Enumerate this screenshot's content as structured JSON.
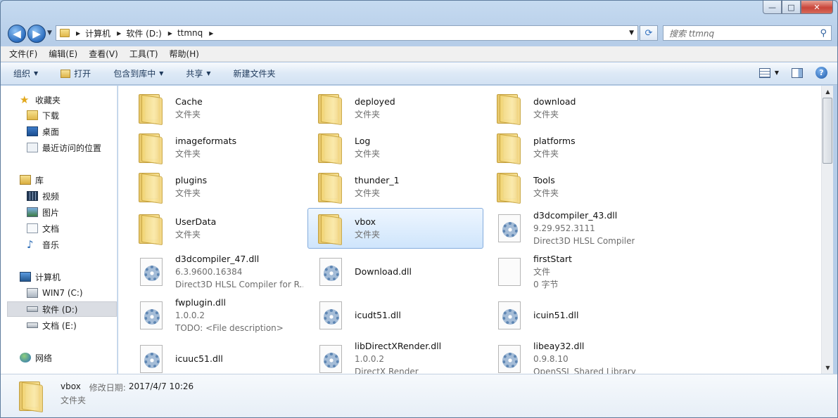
{
  "window": {
    "caption": {
      "minimize": "—",
      "maximize": "□",
      "close": "✕"
    }
  },
  "nav": {
    "back": "◀",
    "forward": "▶"
  },
  "address": {
    "crumbs": [
      "计算机",
      "软件 (D:)",
      "ttmnq"
    ]
  },
  "search": {
    "placeholder": "搜索 ttmnq"
  },
  "menubar": [
    "文件(F)",
    "编辑(E)",
    "查看(V)",
    "工具(T)",
    "帮助(H)"
  ],
  "commands": {
    "organize": "组织",
    "open": "打开",
    "include_library": "包含到库中",
    "share": "共享",
    "new_folder": "新建文件夹"
  },
  "navpane": {
    "favorites": "收藏夹",
    "downloads": "下载",
    "desktop": "桌面",
    "recent": "最近访问的位置",
    "libraries": "库",
    "videos": "视频",
    "pictures": "图片",
    "documents": "文档",
    "music": "音乐",
    "computer": "计算机",
    "drive_c": "WIN7 (C:)",
    "drive_d": "软件 (D:)",
    "drive_e": "文档 (E:)",
    "network": "网络"
  },
  "files": [
    {
      "name": "Cache",
      "line2": "文件夹",
      "line3": "",
      "kind": "folder"
    },
    {
      "name": "deployed",
      "line2": "文件夹",
      "line3": "",
      "kind": "folder"
    },
    {
      "name": "download",
      "line2": "文件夹",
      "line3": "",
      "kind": "folder"
    },
    {
      "name": "imageformats",
      "line2": "文件夹",
      "line3": "",
      "kind": "folder"
    },
    {
      "name": "Log",
      "line2": "文件夹",
      "line3": "",
      "kind": "folder"
    },
    {
      "name": "platforms",
      "line2": "文件夹",
      "line3": "",
      "kind": "folder"
    },
    {
      "name": "plugins",
      "line2": "文件夹",
      "line3": "",
      "kind": "folder"
    },
    {
      "name": "thunder_1",
      "line2": "文件夹",
      "line3": "",
      "kind": "folder"
    },
    {
      "name": "Tools",
      "line2": "文件夹",
      "line3": "",
      "kind": "folder"
    },
    {
      "name": "UserData",
      "line2": "文件夹",
      "line3": "",
      "kind": "folder"
    },
    {
      "name": "vbox",
      "line2": "文件夹",
      "line3": "",
      "kind": "folder",
      "selected": true
    },
    {
      "name": "d3dcompiler_43.dll",
      "line2": "9.29.952.3111",
      "line3": "Direct3D HLSL Compiler",
      "kind": "dll"
    },
    {
      "name": "d3dcompiler_47.dll",
      "line2": "6.3.9600.16384",
      "line3": "Direct3D HLSL Compiler for R...",
      "kind": "dll"
    },
    {
      "name": "Download.dll",
      "line2": "",
      "line3": "",
      "kind": "dll"
    },
    {
      "name": "firstStart",
      "line2": "文件",
      "line3": "0 字节",
      "kind": "file"
    },
    {
      "name": "fwplugin.dll",
      "line2": "1.0.0.2",
      "line3": "TODO: <File description>",
      "kind": "dll"
    },
    {
      "name": "icudt51.dll",
      "line2": "",
      "line3": "",
      "kind": "dll"
    },
    {
      "name": "icuin51.dll",
      "line2": "",
      "line3": "",
      "kind": "dll"
    },
    {
      "name": "icuuc51.dll",
      "line2": "",
      "line3": "",
      "kind": "dll"
    },
    {
      "name": "libDirectXRender.dll",
      "line2": "1.0.0.2",
      "line3": "DirectX Render",
      "kind": "dll"
    },
    {
      "name": "libeay32.dll",
      "line2": "0.9.8.10",
      "line3": "OpenSSL Shared Library",
      "kind": "dll"
    }
  ],
  "details": {
    "name": "vbox",
    "modified_label": "修改日期:",
    "modified_value": "2017/4/7 10:26",
    "type": "文件夹"
  }
}
